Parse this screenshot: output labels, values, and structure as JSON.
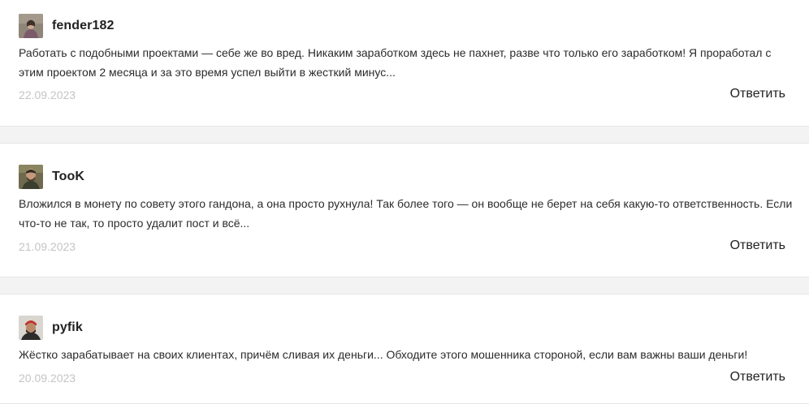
{
  "comments": [
    {
      "username": "fender182",
      "avatar_icon": "user-avatar-icon",
      "text": "Работать с подобными проектами — себе же во вред. Никаким заработком здесь не пахнет, разве что только его заработком! Я проработал с этим проектом 2 месяца и за это время успел выйти в жесткий минус...",
      "date": "22.09.2023",
      "reply_label": "Ответить"
    },
    {
      "username": "TooK",
      "avatar_icon": "user-avatar-icon",
      "text": "Вложился в монету по совету этого гандона, а она просто рухнула! Так более того — он вообще не берет на себя какую-то ответственность. Если что-то не так, то просто удалит пост и всё...",
      "date": "21.09.2023",
      "reply_label": "Ответить"
    },
    {
      "username": "pyfik",
      "avatar_icon": "user-avatar-icon",
      "text": "Жёстко зарабатывает на своих клиентах, причём сливая их деньги... Обходите этого мошенника стороной, если вам важны ваши деньги!",
      "date": "20.09.2023",
      "reply_label": "Ответить"
    }
  ],
  "colors": {
    "separator": "#f3f3f3",
    "date": "#c4c4c4",
    "text": "#2b2b2b"
  }
}
